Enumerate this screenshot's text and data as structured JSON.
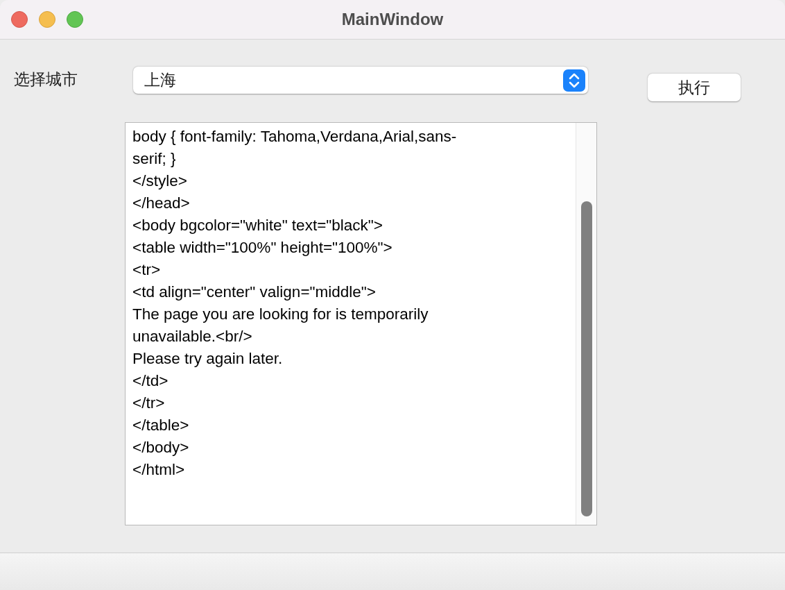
{
  "window": {
    "title": "MainWindow"
  },
  "city": {
    "label": "选择城市",
    "value": "上海"
  },
  "run_button": {
    "label": "执行"
  },
  "editor": {
    "lines": [
      "body { font-family: Tahoma,Verdana,Arial,sans-",
      "serif; }",
      "</style>",
      "</head>",
      "<body bgcolor=\"white\" text=\"black\">",
      "<table width=\"100%\" height=\"100%\">",
      "<tr>",
      "<td align=\"center\" valign=\"middle\">",
      "The page you are looking for is temporarily",
      "unavailable.<br/>",
      "Please try again later.",
      "</td>",
      "</tr>",
      "</table>",
      "</body>",
      "</html>"
    ]
  }
}
